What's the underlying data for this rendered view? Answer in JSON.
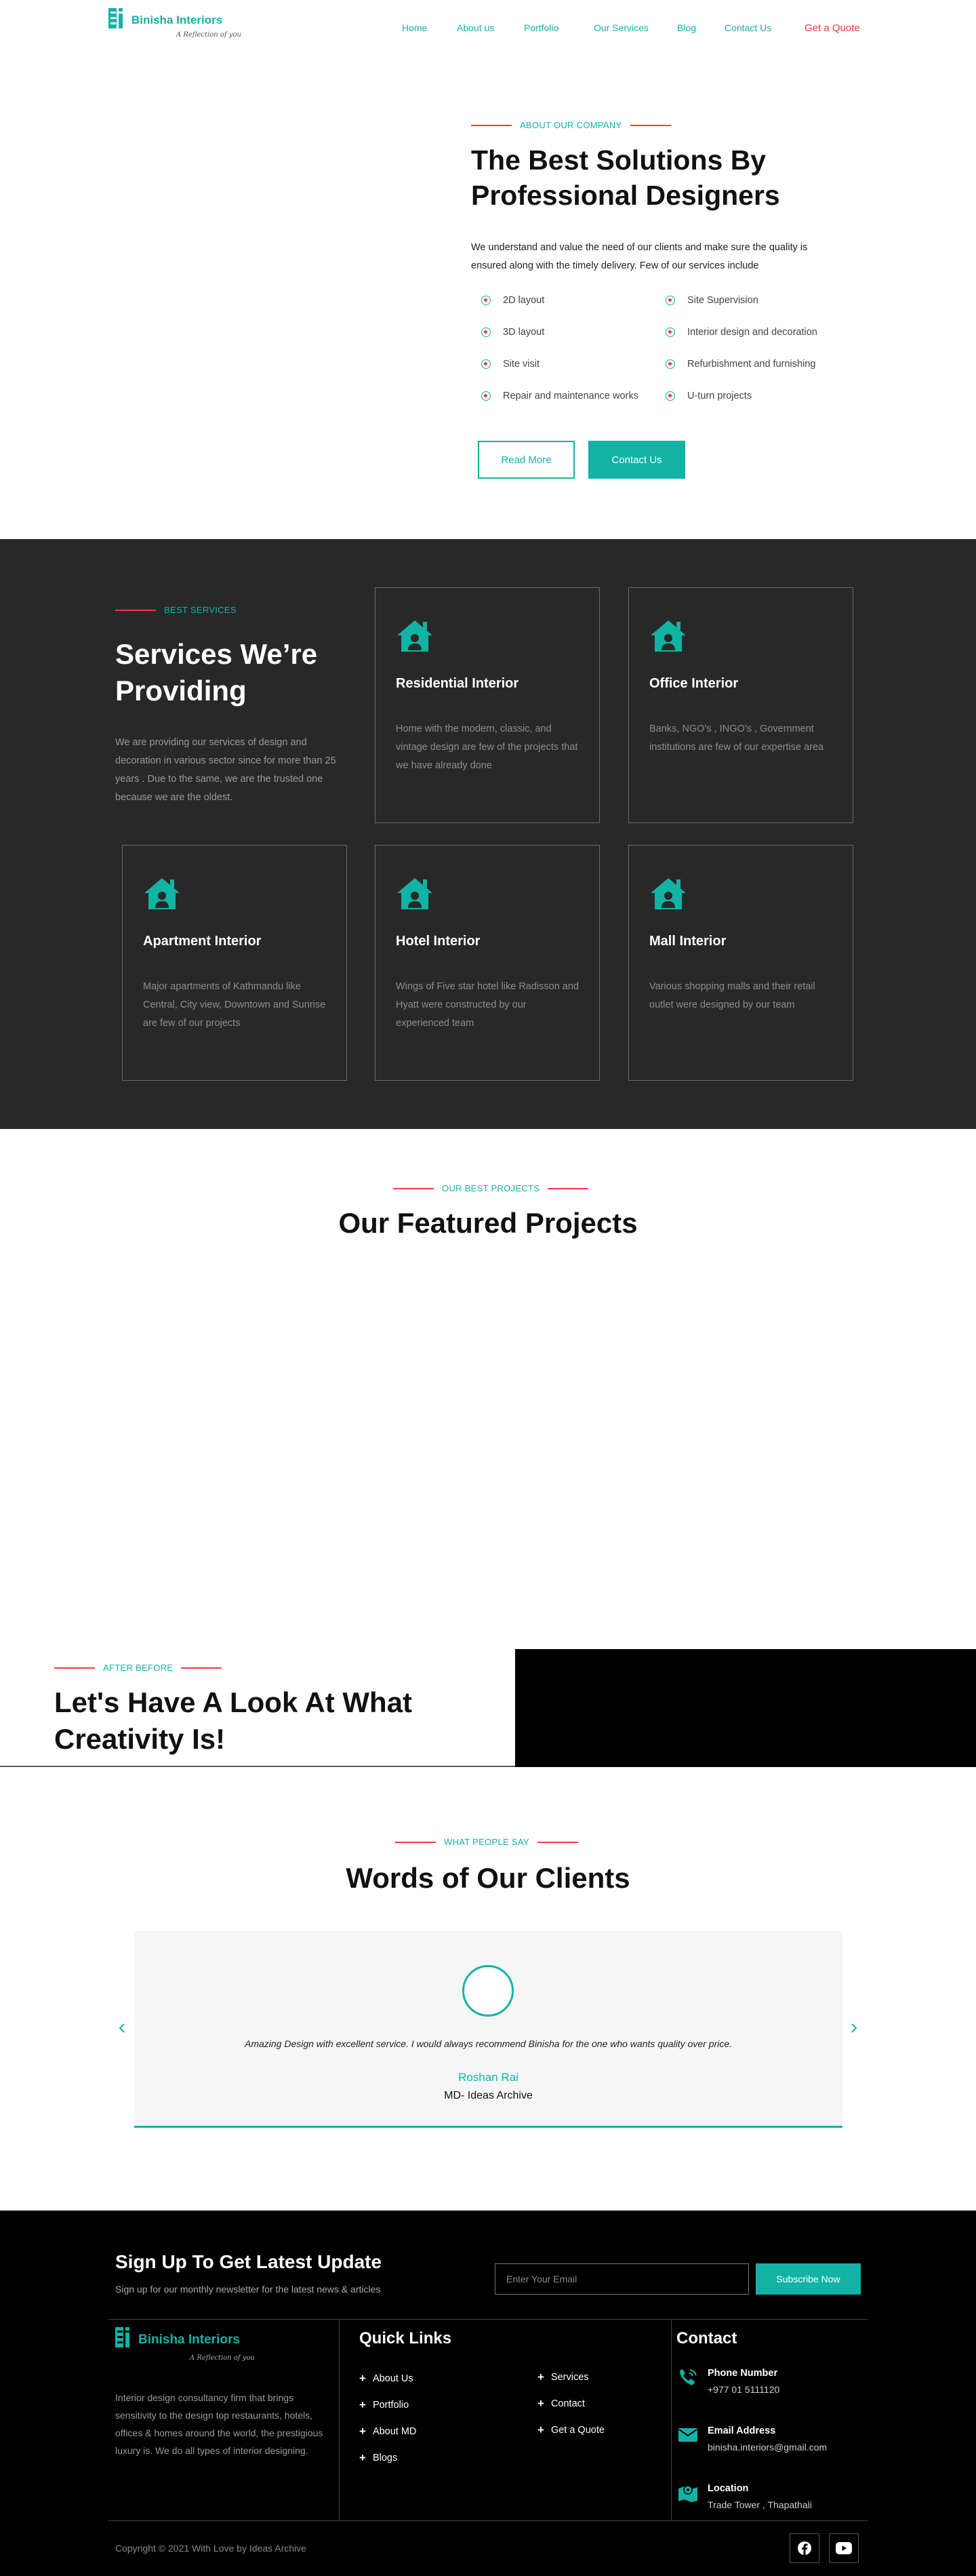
{
  "brand": {
    "name": "Binisha Interiors",
    "tagline": "A Reflection of you",
    "accent": "#12b3a4",
    "secondary": "#ef3b43"
  },
  "nav": {
    "items": [
      "Home",
      "About us",
      "Portfolio",
      "Our Services",
      "Blog",
      "Contact Us"
    ],
    "cta": "Get a Quote"
  },
  "about": {
    "eyebrow": "ABOUT OUR COMPANY",
    "title": "The Best Solutions By Professional Designers",
    "description": "We understand and value the need of our clients and make sure the quality is ensured along with the timely delivery. Few of our services include",
    "features_left": [
      "2D layout",
      "3D layout",
      "Site visit",
      "Repair and maintenance works"
    ],
    "features_right": [
      "Site Supervision",
      "Interior design and decoration",
      "Refurbishment and furnishing",
      "U-turn projects"
    ],
    "read_more": "Read More",
    "contact_us": "Contact Us"
  },
  "services": {
    "eyebrow": "BEST SERVICES",
    "title": "Services We’re Providing",
    "description": "We are providing our services of design and decoration in various sector since for more than 25 years . Due to the same, we are the trusted one because we are the oldest.",
    "cards": [
      {
        "title": "Residential Interior",
        "desc": "Home with the modern, classic, and vintage design are few of the projects that we have already done",
        "icon": "house-user-icon"
      },
      {
        "title": "Office Interior",
        "desc": "Banks, NGO’s , INGO’s , Government institutions are few of our expertise area",
        "icon": "house-user-icon"
      },
      {
        "title": "Apartment Interior",
        "desc": "Major apartments of Kathmandu like Central, City view, Downtown and Sunrise are few of our projects",
        "icon": "house-user-icon"
      },
      {
        "title": "Hotel Interior",
        "desc": "Wings of Five star hotel like Radisson and Hyatt were constructed by our experienced team",
        "icon": "house-user-icon"
      },
      {
        "title": "Mall Interior",
        "desc": "Various shopping malls and their retail outlet were designed by our team",
        "icon": "house-user-icon"
      }
    ]
  },
  "projects": {
    "eyebrow": "OUR BEST PROJECTS",
    "title": "Our Featured Projects"
  },
  "after_before": {
    "eyebrow": "AFTER BEFORE",
    "title": "Let's Have A Look At What Creativity Is!"
  },
  "testimonials": {
    "eyebrow": "WHAT PEOPLE SAY",
    "title": "Words of Our Clients",
    "quote": "Amazing Design with excellent service. I would always recommend Binisha for the one who wants quality over price.",
    "name": "Roshan Rai",
    "role": "MD- Ideas Archive"
  },
  "footer": {
    "newsletter_title": "Sign Up To Get Latest Update",
    "newsletter_sub": "Sign up for our monthly newsletter for the latest news & articles",
    "email_placeholder": "Enter Your Email",
    "subscribe": "Subscribe Now",
    "about": "Interior design consultancy firm that brings sensitivity to the design top restaurants, hotels, offices & homes around the world, the prestigious luxury is. We do all types of interior designing.",
    "quick_links_title": "Quick Links",
    "links_left": [
      "About Us",
      "Portfolio",
      "About MD",
      "Blogs"
    ],
    "links_right": [
      "Services",
      "Contact",
      "Get a Quote"
    ],
    "contact_title": "Contact",
    "phone_label": "Phone Number",
    "phone": "+977 01 5111120",
    "email_label": "Email Address",
    "email": "binisha.interiors@gmail.com",
    "location_label": "Location",
    "location": "Trade Tower , Thapathali",
    "copyright": "Copyright © 2021 With Love by Ideas Archive"
  }
}
